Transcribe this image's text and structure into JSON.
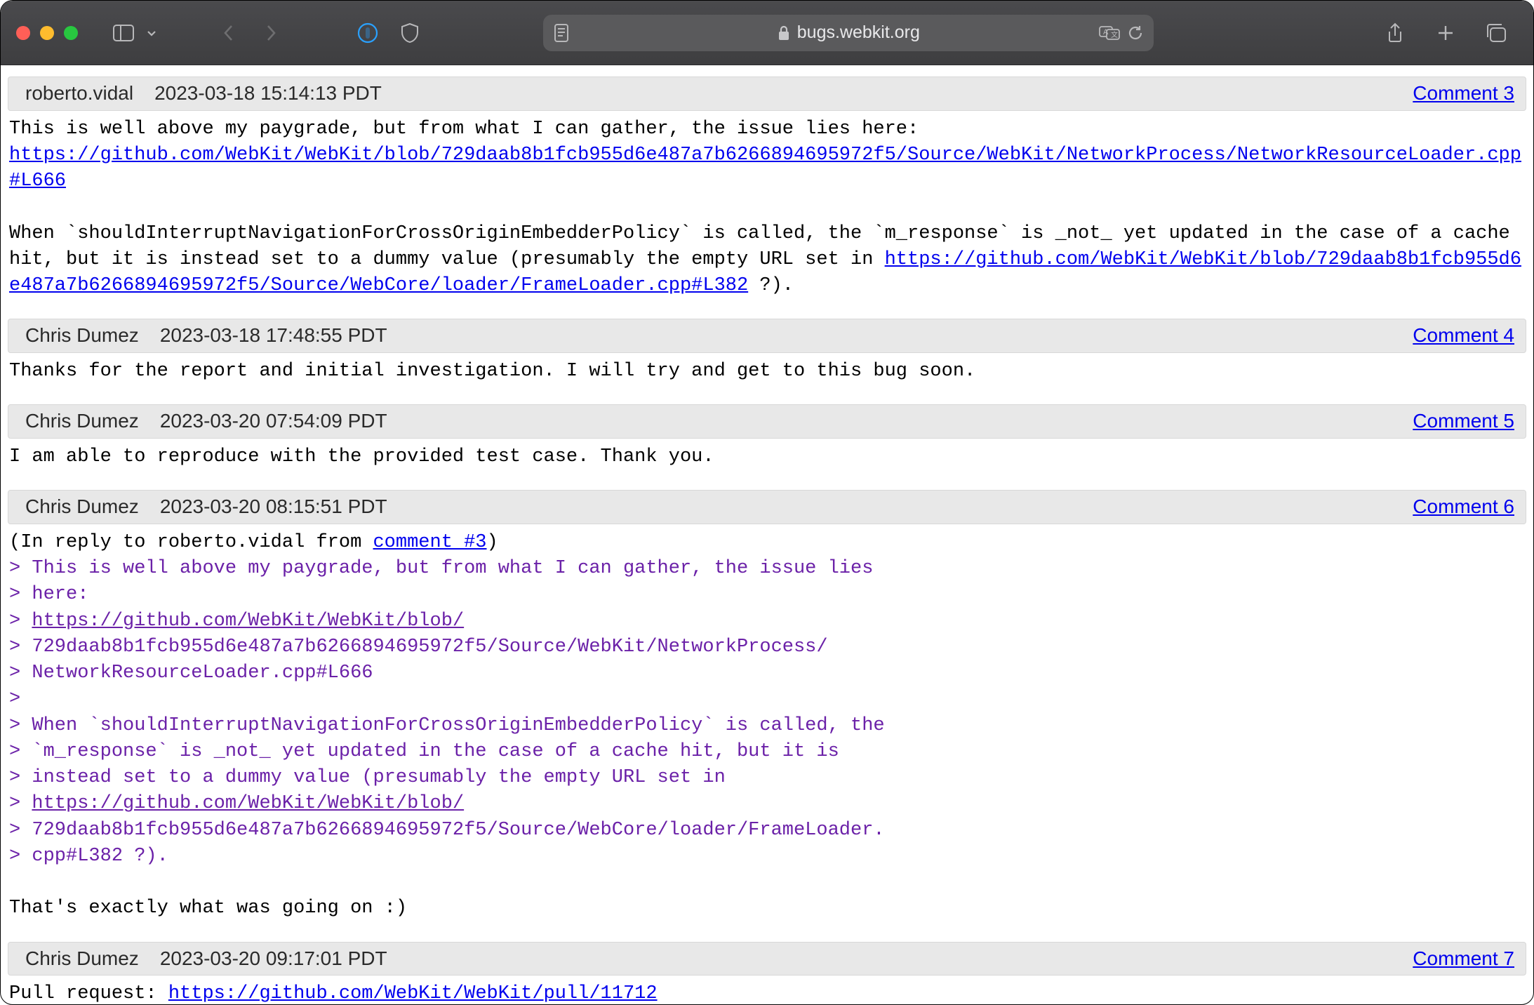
{
  "browser": {
    "url_display": "bugs.webkit.org"
  },
  "comments": [
    {
      "author": "roberto.vidal",
      "timestamp": "2023-03-18 15:14:13 PDT",
      "link_label": "Comment 3",
      "body_pre_link1": "This is well above my paygrade, but from what I can gather, the issue lies here:\n",
      "link1": "https://github.com/WebKit/WebKit/blob/729daab8b1fcb955d6e487a7b6266894695972f5/Source/WebKit/NetworkProcess/NetworkResourceLoader.cpp#L666",
      "body_mid": "\n\nWhen `shouldInterruptNavigationForCrossOriginEmbedderPolicy` is called, the `m_response` is _not_ yet updated in the case of a cache hit, but it is instead set to a dummy value (presumably the empty URL set in ",
      "link2": "https://github.com/WebKit/WebKit/blob/729daab8b1fcb955d6e487a7b6266894695972f5/Source/WebCore/loader/FrameLoader.cpp#L382",
      "body_post": " ?)."
    },
    {
      "author": "Chris Dumez",
      "timestamp": "2023-03-18 17:48:55 PDT",
      "link_label": "Comment 4",
      "body": "Thanks for the report and initial investigation. I will try and get to this bug soon."
    },
    {
      "author": "Chris Dumez",
      "timestamp": "2023-03-20 07:54:09 PDT",
      "link_label": "Comment 5",
      "body": "I am able to reproduce with the provided test case. Thank you."
    },
    {
      "author": "Chris Dumez",
      "timestamp": "2023-03-20 08:15:51 PDT",
      "link_label": "Comment 6",
      "reply_prefix": "(In reply to roberto.vidal from ",
      "reply_link_label": "comment #3",
      "reply_suffix": ")",
      "quote_l1": "> This is well above my paygrade, but from what I can gather, the issue lies",
      "quote_l2": "> here:",
      "quote_l3_prefix": "> ",
      "quote_l3_link": "https://github.com/WebKit/WebKit/blob/",
      "quote_l4": "> 729daab8b1fcb955d6e487a7b6266894695972f5/Source/WebKit/NetworkProcess/",
      "quote_l5": "> NetworkResourceLoader.cpp#L666",
      "quote_l6": "> ",
      "quote_l7": "> When `shouldInterruptNavigationForCrossOriginEmbedderPolicy` is called, the",
      "quote_l8": "> `m_response` is _not_ yet updated in the case of a cache hit, but it is",
      "quote_l9": "> instead set to a dummy value (presumably the empty URL set in",
      "quote_l10_prefix": "> ",
      "quote_l10_link": "https://github.com/WebKit/WebKit/blob/",
      "quote_l11": "> 729daab8b1fcb955d6e487a7b6266894695972f5/Source/WebCore/loader/FrameLoader.",
      "quote_l12": "> cpp#L382 ?).",
      "body_after": "\n\nThat's exactly what was going on :)"
    },
    {
      "author": "Chris Dumez",
      "timestamp": "2023-03-20 09:17:01 PDT",
      "link_label": "Comment 7",
      "body_pre": "Pull request: ",
      "link": "https://github.com/WebKit/WebKit/pull/11712"
    }
  ]
}
